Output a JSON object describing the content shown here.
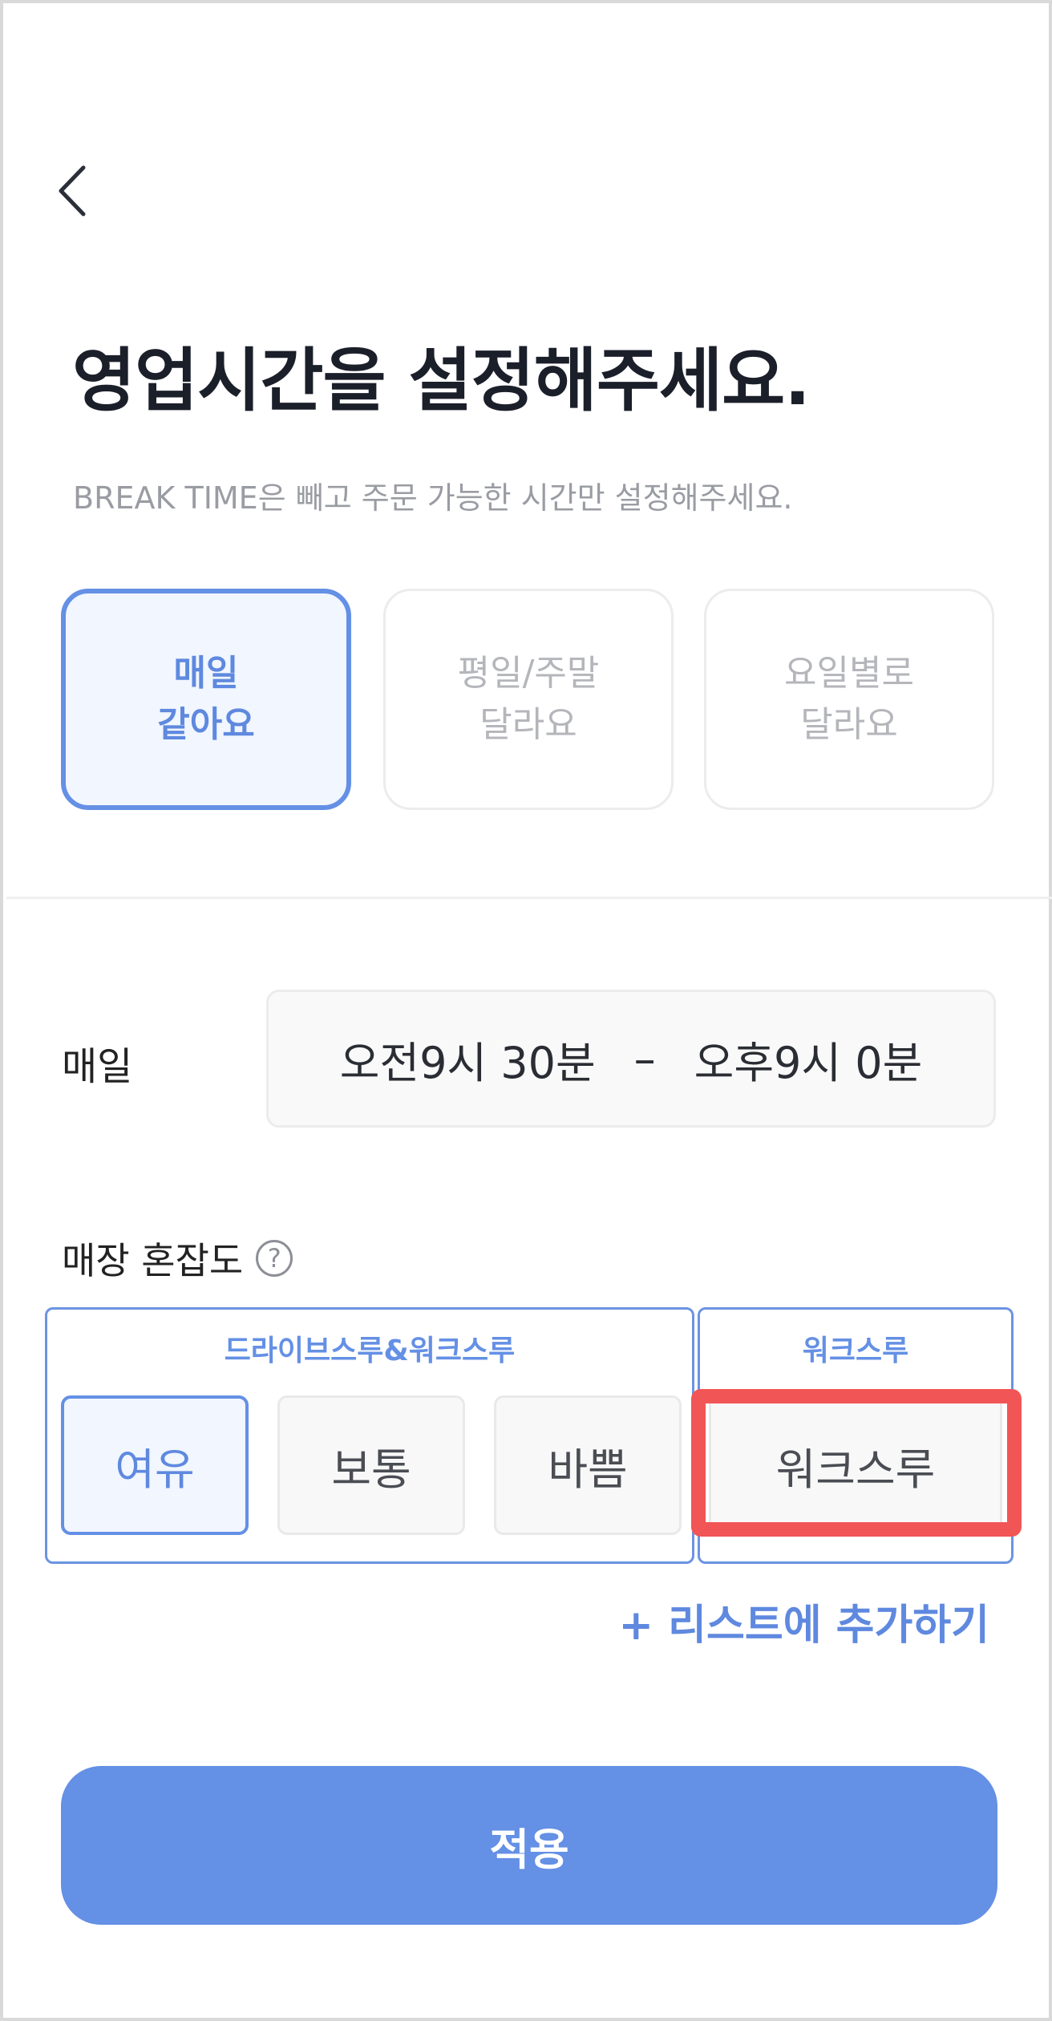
{
  "header": {
    "back_icon": "chevron-left-icon",
    "title": "영업시간을 설정해주세요.",
    "subtitle": "BREAK TIME은 빼고 주문 가능한 시간만 설정해주세요."
  },
  "schedule_modes": [
    {
      "line1": "매일",
      "line2": "같아요",
      "selected": true
    },
    {
      "line1": "평일/주말",
      "line2": "달라요",
      "selected": false
    },
    {
      "line1": "요일별로",
      "line2": "달라요",
      "selected": false
    }
  ],
  "hours": {
    "label": "매일",
    "start": "오전9시 30분",
    "separator": "–",
    "end": "오후9시 0분"
  },
  "congestion": {
    "label": "매장 혼잡도",
    "help_icon": "question-circle-icon",
    "help_symbol": "?",
    "groups": [
      {
        "title": "드라이브스루&워크스루",
        "options": [
          "여유",
          "보통",
          "바쁨"
        ],
        "selected": "여유"
      },
      {
        "title": "워크스루",
        "options": [
          "워크스루"
        ]
      }
    ],
    "add_link": "+ 리스트에 추가하기"
  },
  "apply_button": "적용",
  "colors": {
    "accent": "#6490e5",
    "highlight": "#f25555",
    "title": "#1b1f29",
    "muted": "#9a9ca3"
  }
}
